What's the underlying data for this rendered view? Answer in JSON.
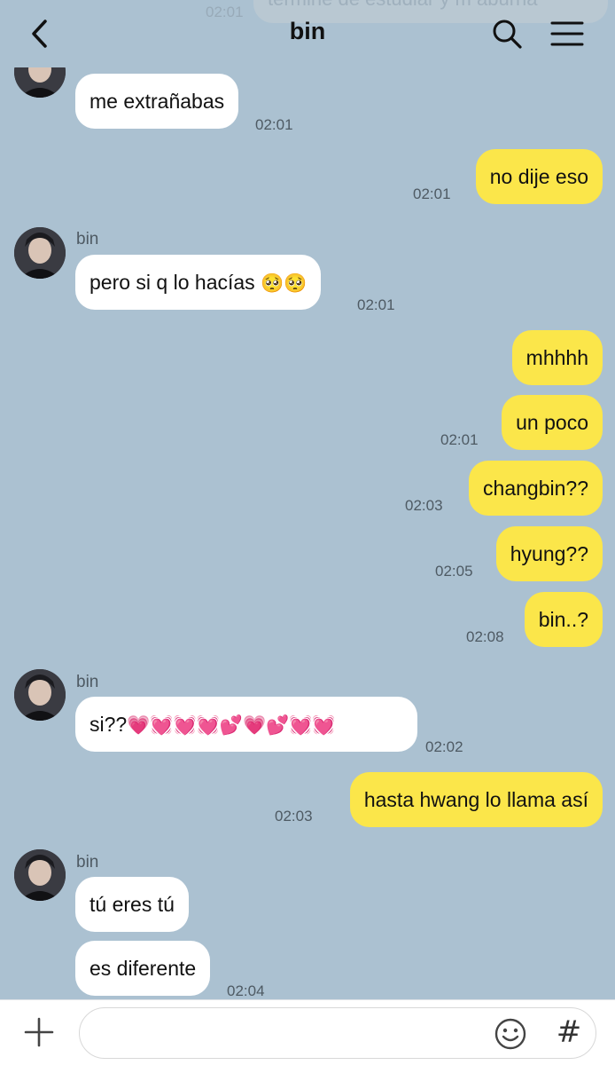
{
  "header": {
    "title": "bin",
    "ghost_message": "termine de estudiar y m aburria",
    "ghost_time": "02:01"
  },
  "contact": {
    "name": "bin"
  },
  "messages": [
    {
      "side": "in",
      "text": "me extrañabas",
      "time": "02:01"
    },
    {
      "side": "out",
      "text": "no dije eso",
      "time": "02:01"
    },
    {
      "side": "in",
      "text": "pero si q lo hacías",
      "emoji": "🥺🥺",
      "time": "02:01"
    },
    {
      "side": "out",
      "text": "mhhhh",
      "time": ""
    },
    {
      "side": "out",
      "text": "un poco",
      "time": "02:01"
    },
    {
      "side": "out",
      "text": "changbin??",
      "time": "02:03"
    },
    {
      "side": "out",
      "text": "hyung??",
      "time": "02:05"
    },
    {
      "side": "out",
      "text": "bin..?",
      "time": "02:08"
    },
    {
      "side": "in",
      "text": "si??",
      "emoji": "💗💓💓💓💕💗💕💓💓",
      "time": "02:02"
    },
    {
      "side": "out",
      "text": "hasta hwang lo llama así",
      "time": "02:03"
    },
    {
      "side": "in",
      "text": "tú eres tú",
      "time": ""
    },
    {
      "side": "in",
      "text": "es diferente",
      "time": "02:04"
    }
  ],
  "input": {
    "placeholder": ""
  },
  "icons": {
    "back": "chevron-left-icon",
    "search": "search-icon",
    "menu": "hamburger-menu-icon",
    "plus": "plus-icon",
    "emoji": "smiley-icon",
    "hash": "#"
  },
  "colors": {
    "background": "#abc1d1",
    "incoming_bubble": "#ffffff",
    "outgoing_bubble": "#fbe64a"
  }
}
